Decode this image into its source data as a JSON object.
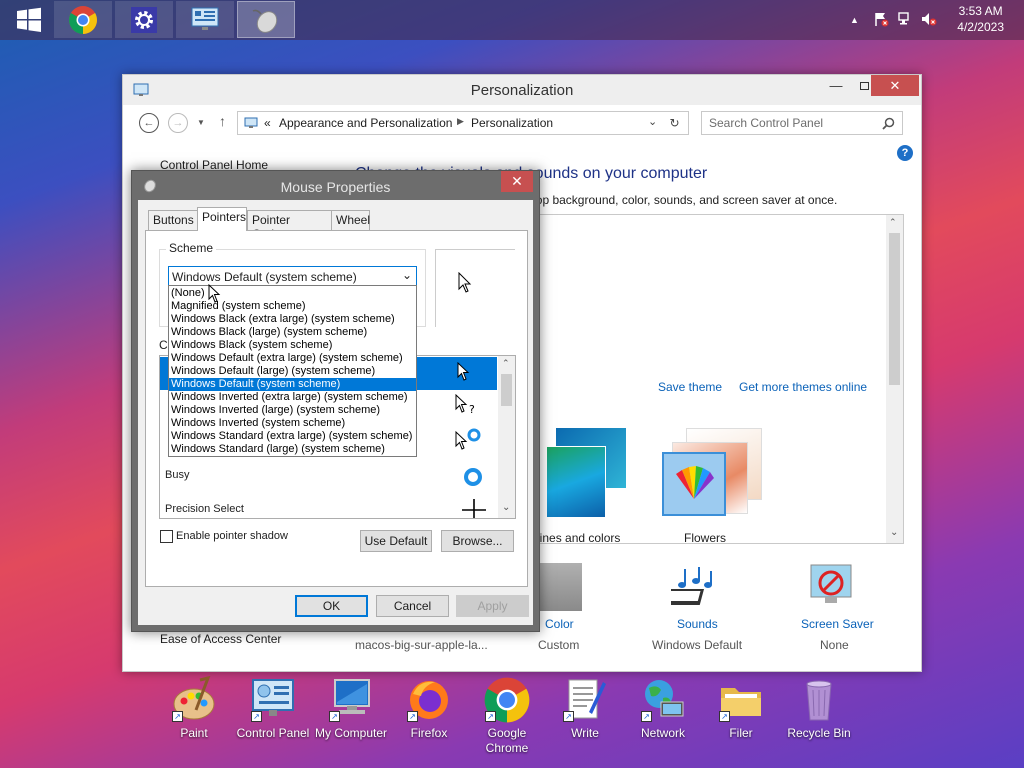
{
  "taskbar": {
    "clock_time": "3:53 AM",
    "clock_date": "4/2/2023",
    "apps": [
      "start-icon",
      "chrome-icon",
      "settings-icon",
      "control-panel-icon",
      "mouse-icon"
    ]
  },
  "personalization": {
    "title": "Personalization",
    "breadcrumb": {
      "prefix": "«",
      "item1": "Appearance and Personalization",
      "item2": "Personalization"
    },
    "search_placeholder": "Search Control Panel",
    "sidebar_top": "Control Panel Home",
    "sidebar_bottom": "Ease of Access Center",
    "heading": "Change the visuals and sounds on your computer",
    "subheading": "Click a theme to change the desktop background, color, sounds, and screen saver at once.",
    "save_theme": "Save theme",
    "more_themes": "Get more themes online",
    "theme_colors_label": "Lines and colors",
    "theme_flowers_label": "Flowers",
    "bottom": {
      "background_label": "macos-big-sur-apple-la...",
      "color_label": "Color",
      "color_value": "Custom",
      "sounds_label": "Sounds",
      "sounds_value": "Windows Default",
      "saver_label": "Screen Saver",
      "saver_value": "None"
    }
  },
  "mouse_dialog": {
    "title": "Mouse Properties",
    "tabs": [
      "Buttons",
      "Pointers",
      "Pointer Options",
      "Wheel"
    ],
    "scheme_label": "Scheme",
    "scheme_selected": "Windows Default (system scheme)",
    "customize_label": "Cu",
    "scheme_options": [
      "(None)",
      "Magnified (system scheme)",
      "Windows Black (extra large) (system scheme)",
      "Windows Black (large) (system scheme)",
      "Windows Black (system scheme)",
      "Windows Default (extra large) (system scheme)",
      "Windows Default (large) (system scheme)",
      "Windows Default (system scheme)",
      "Windows Inverted (extra large) (system scheme)",
      "Windows Inverted (large) (system scheme)",
      "Windows Inverted (system scheme)",
      "Windows Standard (extra large) (system scheme)",
      "Windows Standard (large) (system scheme)"
    ],
    "pointer_rows": {
      "busy": "Busy",
      "precision": "Precision Select"
    },
    "shadow_label": "Enable pointer shadow",
    "use_default": "Use Default",
    "browse": "Browse...",
    "ok": "OK",
    "cancel": "Cancel",
    "apply": "Apply"
  },
  "desktop_icons": [
    {
      "label": "Paint"
    },
    {
      "label": "Control Panel"
    },
    {
      "label": "My Computer"
    },
    {
      "label": "Firefox"
    },
    {
      "label": "Google Chrome"
    },
    {
      "label": "Write"
    },
    {
      "label": "Network"
    },
    {
      "label": "Filer"
    },
    {
      "label": "Recycle Bin"
    }
  ],
  "colors": {
    "accent": "#0078d7",
    "link": "#0b62b8",
    "close_red": "#c75050"
  }
}
